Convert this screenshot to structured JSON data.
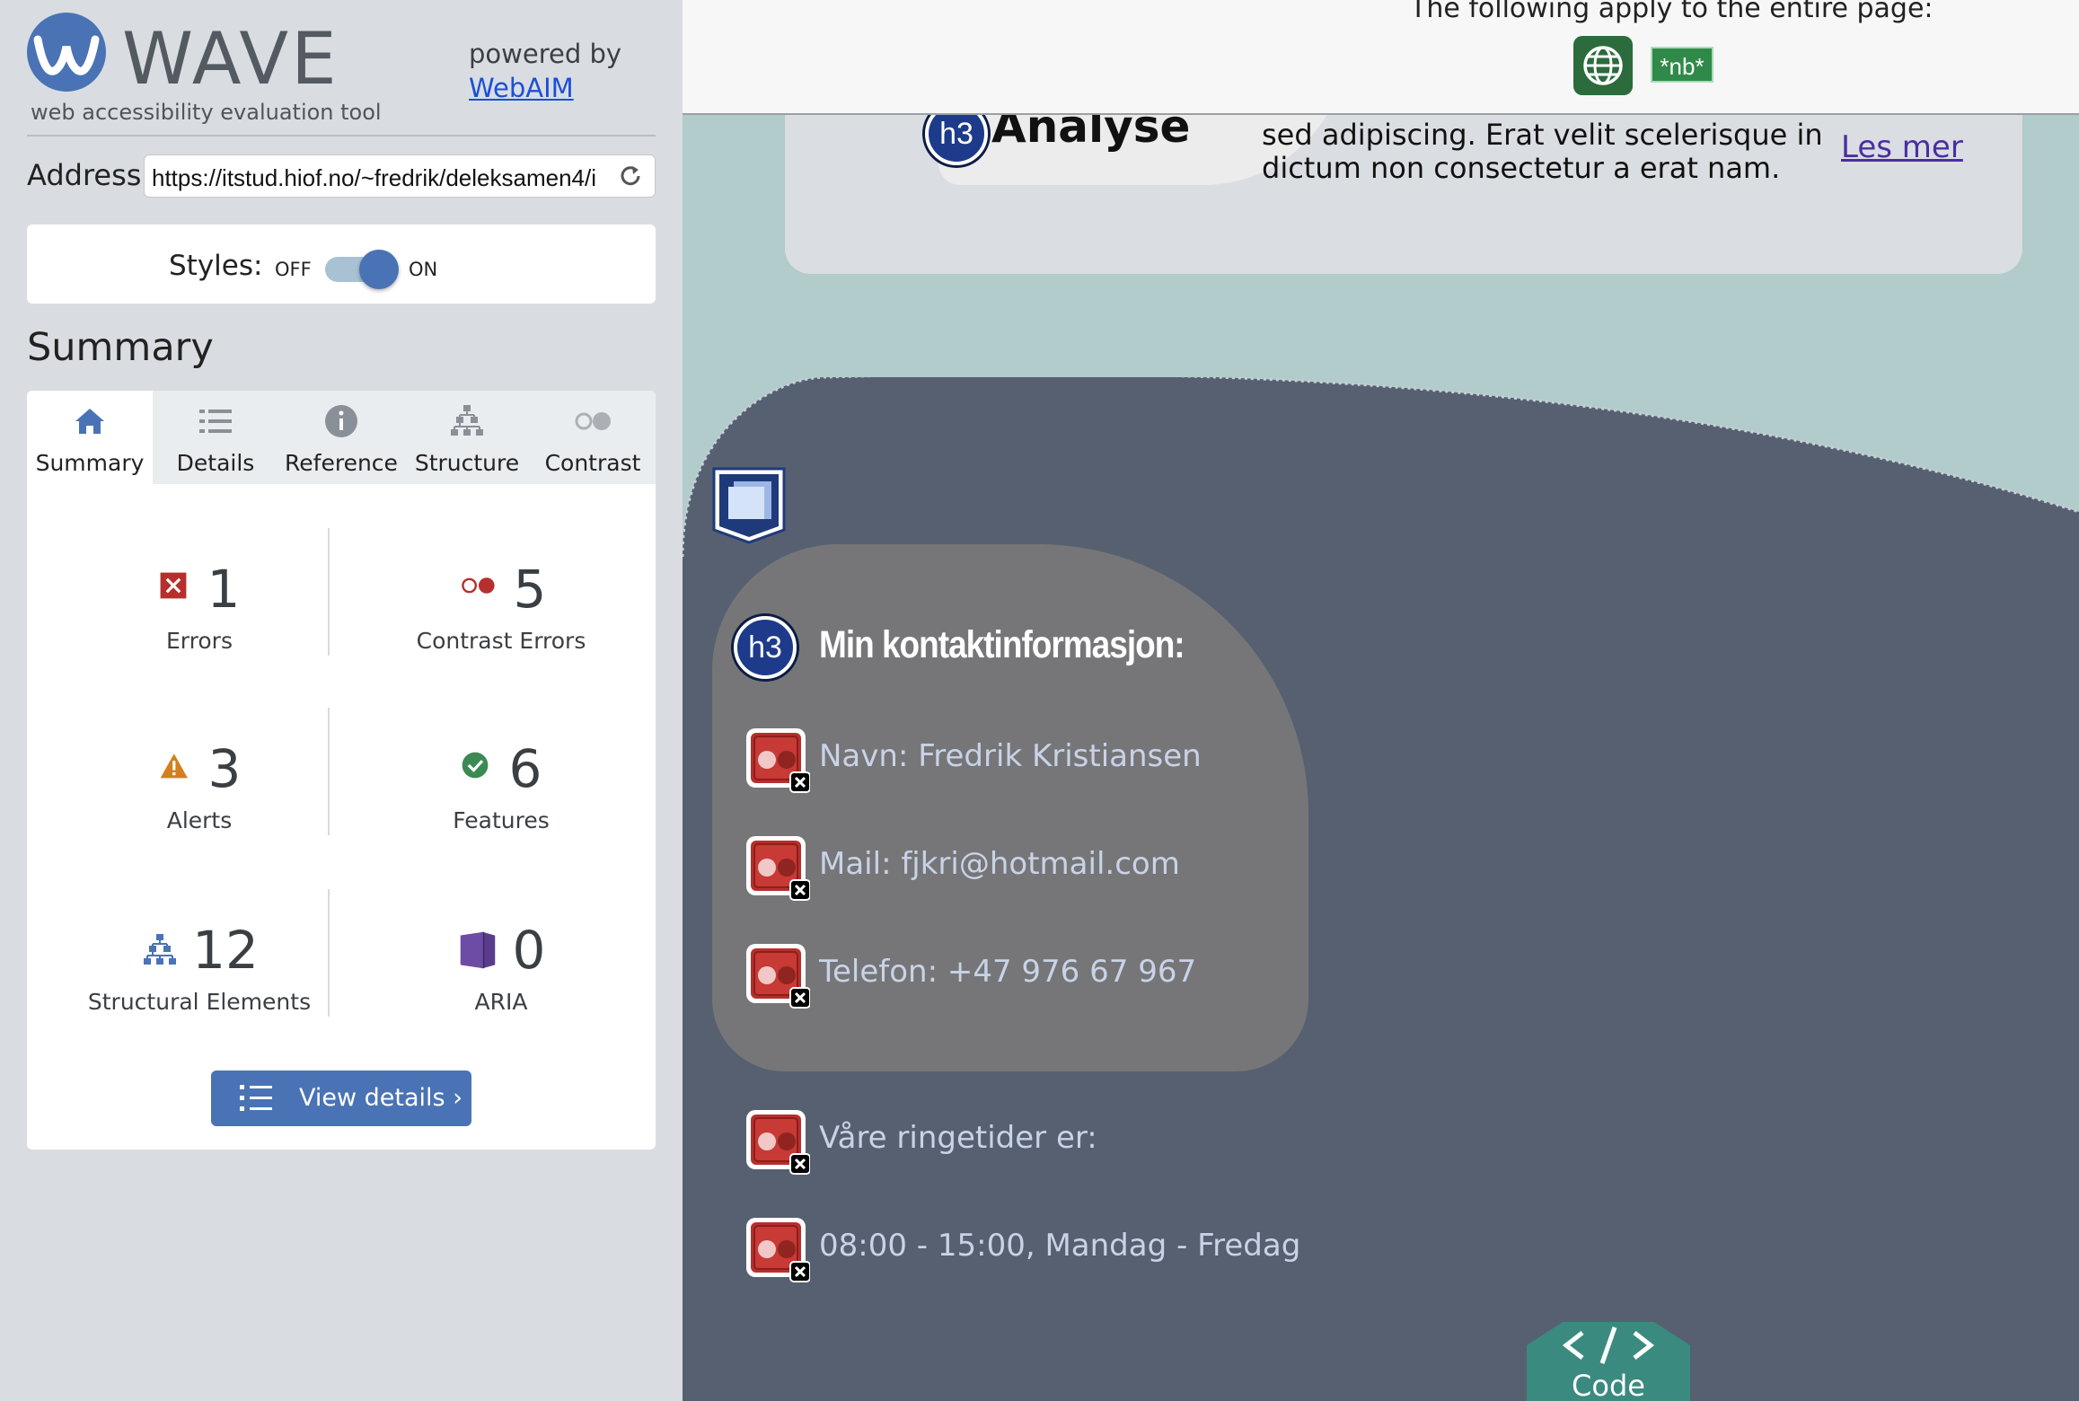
{
  "sidebar": {
    "logo_text": "WAVE",
    "logo_sub": "web accessibility evaluation tool",
    "powered_by": "powered by",
    "webaim_link": "WebAIM",
    "address_label": "Address:",
    "address_value": "https://itstud.hiof.no/~fredrik/deleksamen4/i",
    "styles_label": "Styles:",
    "styles_off": "OFF",
    "styles_on": "ON",
    "styles_state": "on",
    "summary_heading": "Summary",
    "tabs": [
      {
        "label": "Summary",
        "icon": "home-icon",
        "active": true
      },
      {
        "label": "Details",
        "icon": "list-icon",
        "active": false
      },
      {
        "label": "Reference",
        "icon": "info-icon",
        "active": false
      },
      {
        "label": "Structure",
        "icon": "structure-icon",
        "active": false
      },
      {
        "label": "Contrast",
        "icon": "contrast-icon",
        "active": false
      }
    ],
    "stats": {
      "errors": {
        "count": "1",
        "label": "Errors"
      },
      "contrast_errors": {
        "count": "5",
        "label": "Contrast Errors"
      },
      "alerts": {
        "count": "3",
        "label": "Alerts"
      },
      "features": {
        "count": "6",
        "label": "Features"
      },
      "structural": {
        "count": "12",
        "label": "Structural Elements"
      },
      "aria": {
        "count": "0",
        "label": "ARIA"
      }
    },
    "view_details": "View details ›"
  },
  "page": {
    "header_text": "The following apply to the entire page:",
    "nb_badge": "*nb*",
    "analyse_badge": "h3",
    "analyse_title": "Analyse",
    "lorem_text": "sed adipiscing. Erat velit scelerisque in dictum non consectetur a erat nam.",
    "les_mer": "Les mer",
    "contact_badge": "h3",
    "contact_title": "Min kontaktinformasjon:",
    "contact_lines": [
      "Navn: Fredrik Kristiansen",
      "Mail: fjkri@hotmail.com",
      "Telefon: +47 976 67 967"
    ],
    "hours_lines": [
      "Våre ringetider er:",
      "08:00 - 15:00, Mandag - Fredag"
    ],
    "code_label": "Code"
  },
  "colors": {
    "brand_blue": "#4a73b5",
    "error_red": "#b5302d",
    "alert_orange": "#d47f1e",
    "feature_green": "#3b8a53",
    "aria_purple": "#5b3c8c",
    "page_dark": "#566070",
    "page_teal": "#b2cbcb"
  }
}
